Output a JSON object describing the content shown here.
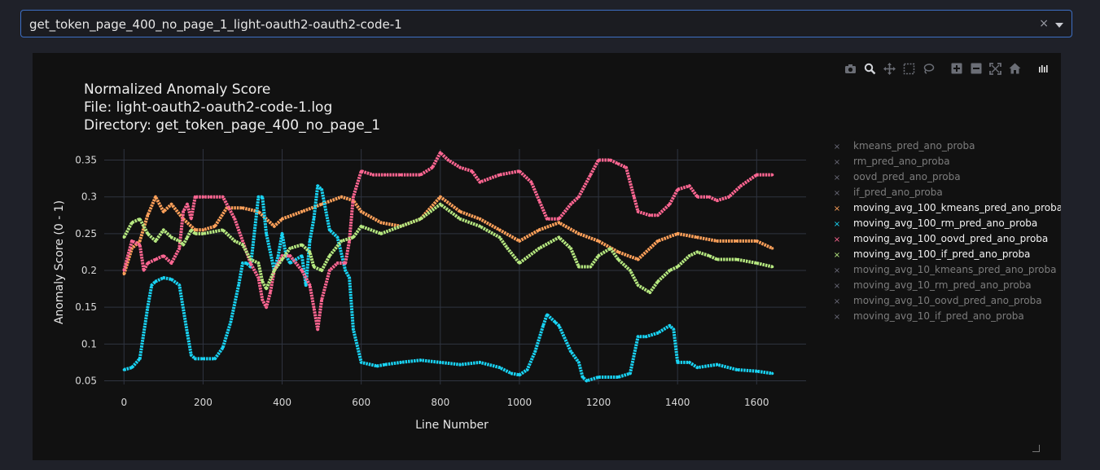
{
  "dropdown": {
    "selected": "get_token_page_400_no_page_1_light-oauth2-oauth2-code-1",
    "clear_glyph": "×"
  },
  "modebar": {
    "icons": [
      "camera-icon",
      "zoom-icon",
      "pan-icon",
      "box-select-icon",
      "lasso-icon",
      "zoom-in-icon",
      "zoom-out-icon",
      "autoscale-icon",
      "reset-axes-icon",
      "plotly-logo-icon"
    ]
  },
  "chart_data": {
    "type": "line",
    "title": "Normalized Anomaly Score",
    "subtitle_lines": [
      "File: light-oauth2-oauth2-code-1.log",
      "Directory: get_token_page_400_no_page_1"
    ],
    "xlabel": "Line Number",
    "ylabel": "Anomaly Score (0 - 1)",
    "xlim": [
      -50,
      1725
    ],
    "ylim": [
      0.045,
      0.365
    ],
    "x_ticks": [
      0,
      200,
      400,
      600,
      800,
      1000,
      1200,
      1400,
      1600
    ],
    "y_ticks": [
      0.05,
      0.1,
      0.15,
      0.2,
      0.25,
      0.3,
      0.35
    ],
    "y_tick_labels": [
      "0.05",
      "0.1",
      "0.15",
      "0.2",
      "0.25",
      "0.3",
      "0.35"
    ],
    "grid": true,
    "legend_position": "right",
    "series": [
      {
        "name": "kmeans_pred_ano_proba",
        "color": "#636efa",
        "visible": false,
        "x": [],
        "y": []
      },
      {
        "name": "rm_pred_ano_proba",
        "color": "#ef553b",
        "visible": false,
        "x": [],
        "y": []
      },
      {
        "name": "oovd_pred_ano_proba",
        "color": "#00cc96",
        "visible": false,
        "x": [],
        "y": []
      },
      {
        "name": "if_pred_ano_proba",
        "color": "#ab63fa",
        "visible": false,
        "x": [],
        "y": []
      },
      {
        "name": "moving_avg_100_kmeans_pred_ano_proba",
        "color": "#ffa15a",
        "visible": true,
        "x": [
          0,
          20,
          40,
          60,
          80,
          100,
          120,
          150,
          180,
          200,
          230,
          260,
          300,
          340,
          380,
          400,
          450,
          500,
          550,
          580,
          600,
          650,
          700,
          750,
          800,
          850,
          900,
          950,
          1000,
          1050,
          1100,
          1150,
          1200,
          1250,
          1300,
          1350,
          1400,
          1450,
          1500,
          1550,
          1600,
          1640
        ],
        "y": [
          0.195,
          0.23,
          0.24,
          0.275,
          0.3,
          0.28,
          0.29,
          0.27,
          0.255,
          0.255,
          0.26,
          0.285,
          0.285,
          0.28,
          0.26,
          0.27,
          0.28,
          0.29,
          0.3,
          0.295,
          0.28,
          0.265,
          0.26,
          0.27,
          0.3,
          0.28,
          0.27,
          0.255,
          0.24,
          0.255,
          0.265,
          0.25,
          0.24,
          0.225,
          0.215,
          0.24,
          0.25,
          0.245,
          0.24,
          0.24,
          0.24,
          0.23
        ]
      },
      {
        "name": "moving_avg_100_rm_pred_ano_proba",
        "color": "#19d3f3",
        "visible": true,
        "x": [
          0,
          20,
          40,
          60,
          70,
          80,
          100,
          120,
          140,
          160,
          170,
          180,
          200,
          230,
          250,
          270,
          290,
          300,
          310,
          320,
          340,
          350,
          360,
          380,
          390,
          400,
          410,
          420,
          450,
          460,
          470,
          480,
          490,
          500,
          520,
          540,
          560,
          570,
          580,
          600,
          640,
          660,
          700,
          750,
          800,
          850,
          900,
          950,
          980,
          1000,
          1020,
          1040,
          1060,
          1070,
          1090,
          1100,
          1130,
          1150,
          1160,
          1170,
          1200,
          1250,
          1280,
          1300,
          1320,
          1350,
          1380,
          1390,
          1400,
          1430,
          1450,
          1500,
          1550,
          1600,
          1640
        ],
        "y": [
          0.065,
          0.068,
          0.08,
          0.15,
          0.18,
          0.185,
          0.19,
          0.188,
          0.18,
          0.115,
          0.085,
          0.08,
          0.08,
          0.08,
          0.095,
          0.13,
          0.18,
          0.21,
          0.21,
          0.205,
          0.3,
          0.3,
          0.25,
          0.2,
          0.22,
          0.25,
          0.22,
          0.21,
          0.22,
          0.18,
          0.24,
          0.27,
          0.315,
          0.31,
          0.255,
          0.245,
          0.2,
          0.19,
          0.12,
          0.075,
          0.07,
          0.072,
          0.075,
          0.078,
          0.075,
          0.072,
          0.075,
          0.068,
          0.06,
          0.058,
          0.065,
          0.09,
          0.125,
          0.14,
          0.13,
          0.125,
          0.09,
          0.075,
          0.055,
          0.05,
          0.055,
          0.055,
          0.06,
          0.11,
          0.11,
          0.115,
          0.125,
          0.12,
          0.075,
          0.075,
          0.068,
          0.072,
          0.065,
          0.063,
          0.06
        ]
      },
      {
        "name": "moving_avg_100_oovd_pred_ano_proba",
        "color": "#ff6692",
        "visible": true,
        "x": [
          0,
          20,
          40,
          50,
          60,
          80,
          100,
          120,
          140,
          150,
          160,
          170,
          180,
          200,
          220,
          250,
          280,
          300,
          320,
          340,
          350,
          360,
          370,
          380,
          400,
          420,
          450,
          470,
          480,
          490,
          500,
          520,
          540,
          560,
          570,
          580,
          600,
          630,
          660,
          700,
          750,
          780,
          800,
          820,
          850,
          880,
          900,
          950,
          1000,
          1030,
          1050,
          1070,
          1100,
          1130,
          1150,
          1180,
          1200,
          1230,
          1250,
          1270,
          1290,
          1300,
          1330,
          1350,
          1380,
          1400,
          1430,
          1450,
          1480,
          1500,
          1530,
          1560,
          1600,
          1640
        ],
        "y": [
          0.2,
          0.24,
          0.235,
          0.2,
          0.21,
          0.215,
          0.22,
          0.21,
          0.23,
          0.28,
          0.29,
          0.27,
          0.3,
          0.3,
          0.3,
          0.3,
          0.27,
          0.24,
          0.21,
          0.19,
          0.16,
          0.15,
          0.17,
          0.2,
          0.22,
          0.22,
          0.2,
          0.18,
          0.15,
          0.12,
          0.16,
          0.2,
          0.21,
          0.21,
          0.24,
          0.3,
          0.335,
          0.33,
          0.33,
          0.33,
          0.33,
          0.34,
          0.36,
          0.35,
          0.34,
          0.335,
          0.32,
          0.33,
          0.335,
          0.32,
          0.295,
          0.27,
          0.27,
          0.29,
          0.3,
          0.33,
          0.35,
          0.35,
          0.345,
          0.34,
          0.3,
          0.28,
          0.275,
          0.275,
          0.29,
          0.31,
          0.315,
          0.3,
          0.3,
          0.295,
          0.3,
          0.315,
          0.33,
          0.33
        ]
      },
      {
        "name": "moving_avg_100_if_pred_ano_proba",
        "color": "#b6e880",
        "visible": true,
        "x": [
          0,
          20,
          40,
          60,
          80,
          100,
          120,
          140,
          150,
          160,
          170,
          180,
          200,
          250,
          280,
          300,
          320,
          340,
          350,
          360,
          380,
          400,
          420,
          450,
          470,
          480,
          500,
          520,
          550,
          580,
          600,
          650,
          700,
          750,
          800,
          850,
          900,
          950,
          970,
          1000,
          1050,
          1100,
          1130,
          1150,
          1180,
          1200,
          1230,
          1250,
          1280,
          1300,
          1330,
          1350,
          1380,
          1400,
          1430,
          1450,
          1480,
          1500,
          1550,
          1600,
          1640
        ],
        "y": [
          0.245,
          0.265,
          0.27,
          0.25,
          0.24,
          0.255,
          0.245,
          0.24,
          0.235,
          0.245,
          0.255,
          0.25,
          0.25,
          0.255,
          0.24,
          0.235,
          0.215,
          0.21,
          0.185,
          0.175,
          0.2,
          0.215,
          0.23,
          0.235,
          0.225,
          0.205,
          0.2,
          0.22,
          0.24,
          0.245,
          0.26,
          0.25,
          0.26,
          0.27,
          0.29,
          0.27,
          0.26,
          0.245,
          0.23,
          0.21,
          0.23,
          0.245,
          0.23,
          0.205,
          0.205,
          0.22,
          0.23,
          0.215,
          0.2,
          0.18,
          0.17,
          0.185,
          0.2,
          0.205,
          0.22,
          0.225,
          0.22,
          0.215,
          0.215,
          0.21,
          0.205
        ]
      },
      {
        "name": "moving_avg_10_kmeans_pred_ano_proba",
        "color": "#ff97ff",
        "visible": false,
        "x": [],
        "y": []
      },
      {
        "name": "moving_avg_10_rm_pred_ano_proba",
        "color": "#fecb52",
        "visible": false,
        "x": [],
        "y": []
      },
      {
        "name": "moving_avg_10_oovd_pred_ano_proba",
        "color": "#636efa",
        "visible": false,
        "x": [],
        "y": []
      },
      {
        "name": "moving_avg_10_if_pred_ano_proba",
        "color": "#ef553b",
        "visible": false,
        "x": [],
        "y": []
      }
    ]
  }
}
